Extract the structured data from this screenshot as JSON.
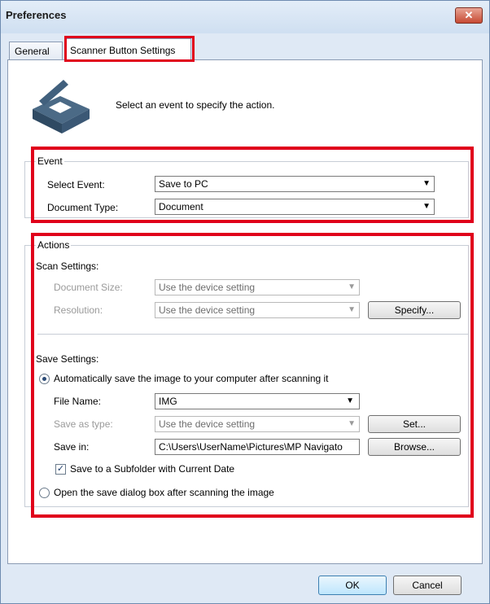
{
  "window": {
    "title": "Preferences",
    "close_glyph": "✕"
  },
  "tabs": [
    {
      "label": "General",
      "active": false
    },
    {
      "label": "Scanner Button Settings",
      "active": true
    }
  ],
  "intro": {
    "text": "Select an event to specify the action.",
    "icon": "scanner-icon"
  },
  "event": {
    "legend": "Event",
    "select_event_label": "Select Event:",
    "select_event_value": "Save to PC",
    "document_type_label": "Document Type:",
    "document_type_value": "Document"
  },
  "actions": {
    "legend": "Actions",
    "scan_settings_label": "Scan Settings:",
    "document_size_label": "Document Size:",
    "document_size_value": "Use the device setting",
    "resolution_label": "Resolution:",
    "resolution_value": "Use the device setting",
    "specify_button": "Specify...",
    "save_settings_label": "Save Settings:",
    "auto_save_label": "Automatically save the image to your computer after scanning it",
    "file_name_label": "File Name:",
    "file_name_value": "IMG",
    "save_as_type_label": "Save as type:",
    "save_as_type_value": "Use the device setting",
    "set_button": "Set...",
    "save_in_label": "Save in:",
    "save_in_value": "C:\\Users\\UserName\\Pictures\\MP Navigato",
    "browse_button": "Browse...",
    "subfolder_label": "Save to a Subfolder with Current Date",
    "subfolder_checked": true,
    "open_dialog_label": "Open the save dialog box after scanning the image"
  },
  "footer": {
    "ok": "OK",
    "cancel": "Cancel"
  },
  "colors": {
    "highlight": "#e0001b",
    "accent": "#3c7fb1"
  }
}
